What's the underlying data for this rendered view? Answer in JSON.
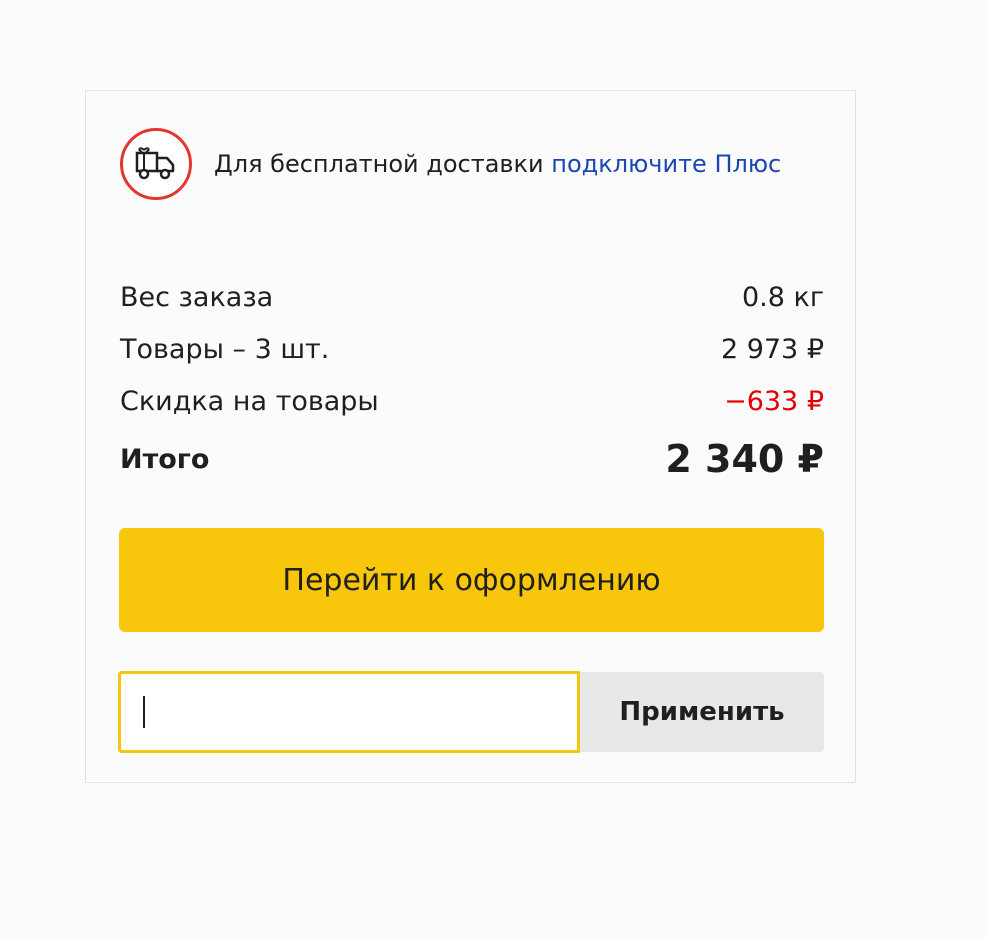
{
  "promo": {
    "text": "Для бесплатной доставки",
    "link": "подключите Плюс",
    "icon": "gift-truck-icon",
    "icon_ring_color": "#e0382e",
    "link_color": "#1a47b0"
  },
  "summary": {
    "weight_label": "Вес заказа",
    "weight_value": "0.8 кг",
    "items_label": "Товары – 3 шт.",
    "items_value": "2 973 ₽",
    "discount_label": "Скидка на товары",
    "discount_value": "−633 ₽",
    "discount_color": "#e60000",
    "total_label": "Итого",
    "total_value": "2 340 ₽"
  },
  "checkout": {
    "label": "Перейти к оформлению",
    "color": "#f8c60a"
  },
  "promo_code": {
    "value": "",
    "apply_label": "Применить"
  }
}
